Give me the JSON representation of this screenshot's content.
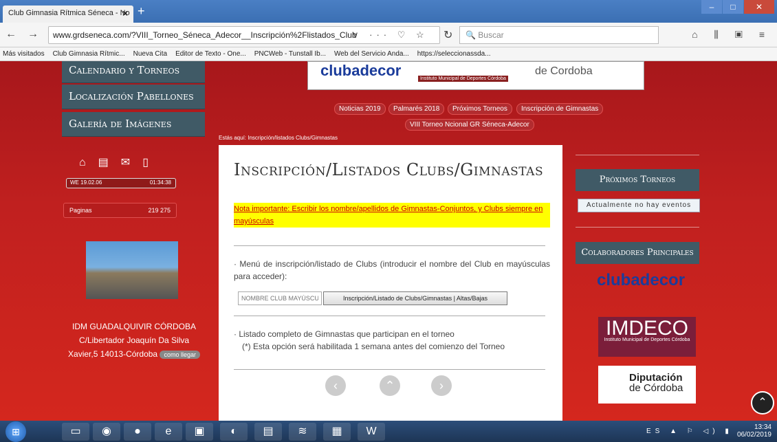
{
  "browser": {
    "tab_title": "Club Gimnasia Rítmica Séneca - No",
    "url": "www.grdseneca.com/?VIII_Torneo_Séneca_Adecor__Inscripción%2Flistados_Club",
    "search_placeholder": "Buscar"
  },
  "bookmarks": [
    "Más visitados",
    "Club Gimnasia Rítmic...",
    "Nueva Cita",
    "Editor de Texto - One...",
    "PNCWeb - Tunstall Ib...",
    "Web del Servicio Anda...",
    "https://seleccionassda..."
  ],
  "left_menu": [
    "Calendario y Torneos",
    "Localización Pabellones",
    "Galería de Imágenes"
  ],
  "clock": {
    "left": "WE",
    "date": "19.02.06",
    "time": "01:34:38"
  },
  "pages_counter": {
    "label": "Paginas",
    "count": "219 275"
  },
  "address": {
    "name": "IDM GUADALQUIVIR CÓRDOBA",
    "line1": "C/Libertador Joaquín Da Silva",
    "line2": "Xavier,5 14013-Córdoba",
    "map_button": "como llegar"
  },
  "banner": {
    "brand": "clubadecor",
    "sub": "Instituto Municipal de Deportes Córdoba",
    "right": "de Cordoba"
  },
  "nav_pills": [
    "Noticias 2019",
    "Palmarés 2018",
    "Próximos Torneos",
    "Inscripción de Gimnastas",
    "VIII Torneo Ncional GR Séneca-Adecor"
  ],
  "breadcrumb": "Estás aquí:  Inscripción/listados Clubs/Gimnastas",
  "main": {
    "title": "Inscripción/Listados Clubs/Gimnastas",
    "note": "Nota importante: Escribir los nombre/apellidos de Gimnastas-Conjuntos, y Clubs siempre en mayúsculas",
    "menu_text": "· Menú de inscripción/listado de Clubs (introducir el nombre del Club en mayúsculas para acceder):",
    "club_placeholder": "NOMBRE CLUB MAYÚSCU",
    "club_button": "Inscripción/Listado de Clubs/Gimnastas | Altas/Bajas",
    "listado": "· Listado completo de Gimnastas que participan en el torneo",
    "listado_sub": "(*) Esta opción será habilitada 1 semana antes del comienzo del Torneo"
  },
  "right": {
    "proximos": "Próximos Torneos",
    "no_eventos": "Actualmente no hay eventos",
    "colaboradores": "Colaboradores Principales",
    "logo1": "clubadecor",
    "logo2": "IMDECO",
    "logo2_sub": "Instituto Municipal de Deportes Córdoba",
    "logo3a": "Diputación",
    "logo3b": "de Córdoba"
  },
  "tray": {
    "lang": "ES",
    "time": "13:34",
    "date": "06/02/2019"
  }
}
